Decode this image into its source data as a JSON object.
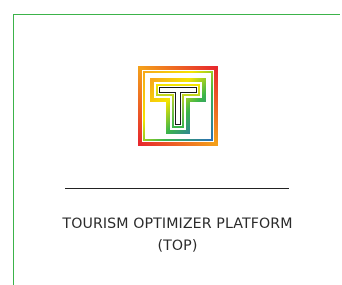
{
  "card": {
    "accent_color": "#3cb34a",
    "logo": {
      "icon": "top-logo-icon",
      "letter": "T",
      "gradient_colors": [
        "#f4a11a",
        "#e7282d",
        "#f5e400",
        "#3bb54a",
        "#2b6fb6"
      ]
    },
    "title_line1": "TOURISM OPTIMIZER PLATFORM",
    "title_line2": "(TOP)"
  }
}
